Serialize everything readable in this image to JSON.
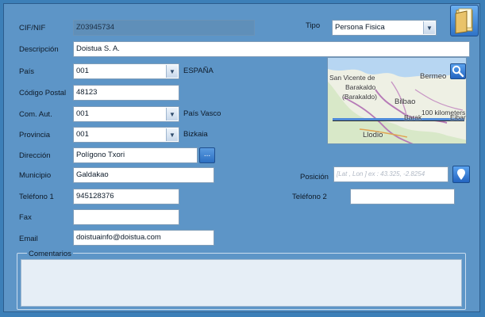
{
  "form": {
    "cif_label": "CIF/NIF",
    "cif_value": "Z03945734",
    "tipo_label": "Tipo",
    "tipo_value": "Persona Fisica",
    "descripcion_label": "Descripción",
    "descripcion_value": "Doistua S. A.",
    "pais_label": "País",
    "pais_value": "001",
    "pais_name": "ESPAÑA",
    "cp_label": "Código Postal",
    "cp_value": "48123",
    "comaut_label": "Com. Aut.",
    "comaut_value": "001",
    "comaut_name": "País Vasco",
    "provincia_label": "Provincia",
    "provincia_value": "001",
    "provincia_name": "Bizkaia",
    "direccion_label": "Dirección",
    "direccion_value": "Polígono Txori",
    "direccion_button": "...",
    "municipio_label": "Municipio",
    "municipio_value": "Galdakao",
    "posicion_label": "Posición",
    "posicion_placeholder": "[Lat , Lon ] ex : 43.325, -2.8254",
    "telefono1_label": "Teléfono 1",
    "telefono1_value": "945128376",
    "telefono2_label": "Teléfono 2",
    "telefono2_value": "",
    "fax_label": "Fax",
    "fax_value": "",
    "email_label": "Email",
    "email_value": "doistuainfo@doistua.com",
    "comentarios_label": "Comentarios",
    "comentarios_value": ""
  },
  "map": {
    "labels": {
      "san_vicente": "San Vicente de",
      "barakaldo": "Barakaldo",
      "barakaldo_paren": "(Barakaldo)",
      "bilbao": "Bilbao",
      "bermeo": "Bermeo",
      "scale": "100 kilometers",
      "eibar": "Eibar",
      "lliodio": "Llodio",
      "baracaldo2": "Barak"
    },
    "icon": "search-icon"
  },
  "colors": {
    "background": "#3c7fb8",
    "panel": "#5d95c7",
    "field_bg": "#ffffff",
    "button_blue": "#2b6fc2"
  }
}
